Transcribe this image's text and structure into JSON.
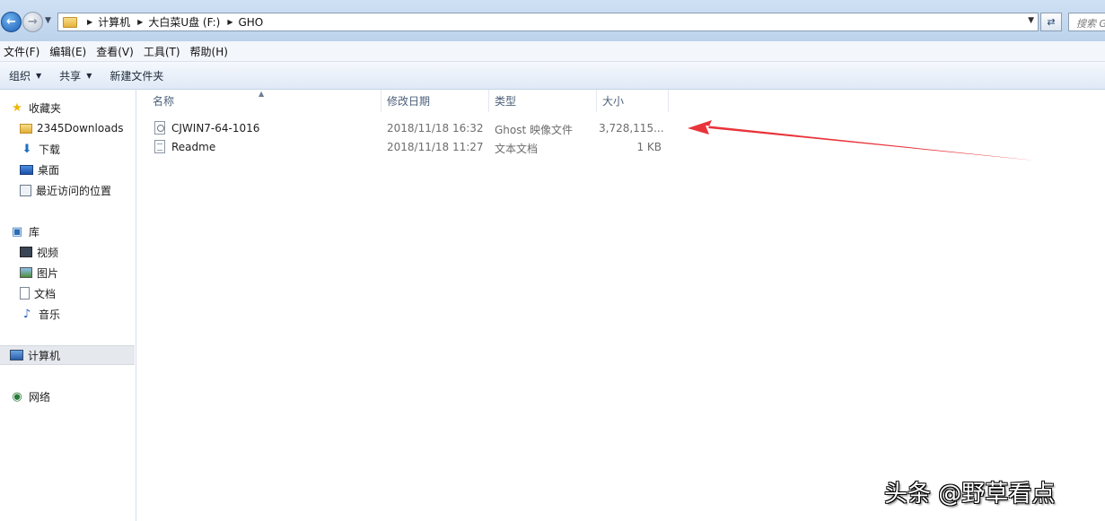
{
  "address_bar": {
    "breadcrumbs": [
      "计算机",
      "大白菜U盘 (F:)",
      "GHO"
    ],
    "search_placeholder": "搜索 GHO"
  },
  "menu": [
    "文件(F)",
    "编辑(E)",
    "查看(V)",
    "工具(T)",
    "帮助(H)"
  ],
  "command_bar": {
    "organize": "组织",
    "share": "共享",
    "new_folder": "新建文件夹"
  },
  "nav": {
    "favorites": {
      "label": "收藏夹",
      "items": [
        "2345Downloads",
        "下载",
        "桌面",
        "最近访问的位置"
      ]
    },
    "libraries": {
      "label": "库",
      "items": [
        "视频",
        "图片",
        "文档",
        "音乐"
      ]
    },
    "computer": "计算机",
    "network": "网络"
  },
  "columns": {
    "name": "名称",
    "modified": "修改日期",
    "type": "类型",
    "size": "大小"
  },
  "files": [
    {
      "name": "CJWIN7-64-1016",
      "modified": "2018/11/18 16:32",
      "type": "Ghost 映像文件",
      "size": "3,728,115...",
      "icon": "ghost-image-file-icon"
    },
    {
      "name": "Readme",
      "modified": "2018/11/18 11:27",
      "type": "文本文档",
      "size": "1 KB",
      "icon": "text-file-icon"
    }
  ],
  "annotation_color": "#e8343a",
  "watermark": "头条 @野草看点"
}
